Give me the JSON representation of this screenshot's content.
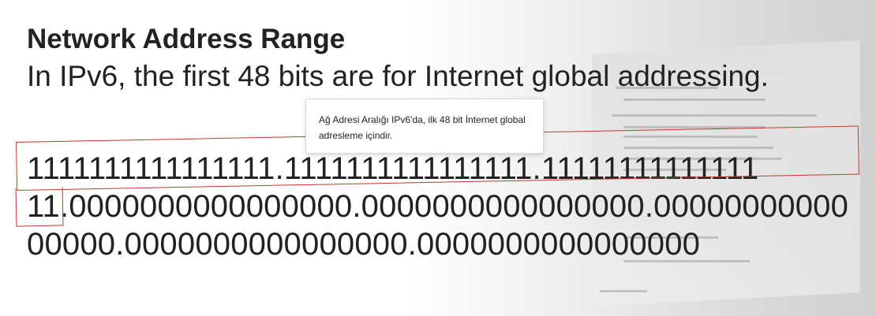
{
  "slide": {
    "title": "Network Address Range",
    "subtitle": "In IPv6, the first 48 bits are for Internet global addressing.",
    "binary_lines": [
      "1111111111111111.1111111111111111.11111111111111",
      "11.0000000000000000.0000000000000000.00000000000",
      "00000.0000000000000000.0000000000000000"
    ]
  },
  "tooltip": {
    "text": "Ağ Adresi Aralığı IPv6'da, ilk 48 bit İnternet global adresleme içindir."
  },
  "colors": {
    "highlight": "#c0392b",
    "text": "#222222"
  }
}
